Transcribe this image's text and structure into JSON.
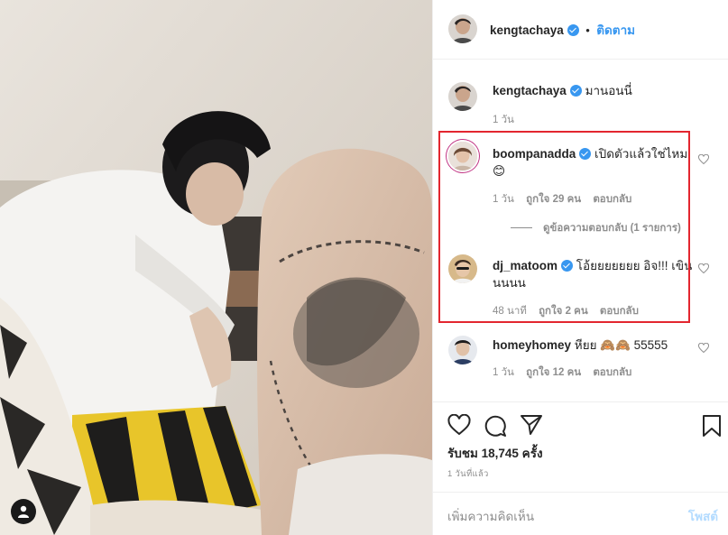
{
  "post": {
    "author": "kengtachaya",
    "follow_label": "ติดตาม",
    "more_label": "..."
  },
  "caption": {
    "user": "kengtachaya",
    "text": "มานอนนี่",
    "time": "1 วัน"
  },
  "comments": [
    {
      "user": "boompanadda",
      "text": "เปิดตัวแล้วใช่ไหม😊",
      "time": "1 วัน",
      "likes": "ถูกใจ 29 คน",
      "reply": "ตอบกลับ",
      "view_replies": "ดูข้อความตอบกลับ (1 รายการ)"
    },
    {
      "user": "dj_matoom",
      "text": "โอ้ยยยยยยย อิจ!!! เขินนนนน",
      "time": "48 นาที",
      "likes": "ถูกใจ 2 คน",
      "reply": "ตอบกลับ"
    },
    {
      "user": "homeyhomey",
      "text": "หียย 🙈🙈 55555",
      "time": "1 วัน",
      "likes": "ถูกใจ 12 คน",
      "reply": "ตอบกลับ"
    }
  ],
  "stats": {
    "views": "รับชม 18,745 ครั้ง",
    "time_ago": "1 วันที่แล้ว"
  },
  "composer": {
    "placeholder": "เพิ่มความคิดเห็น",
    "post_label": "โพสต์"
  },
  "icons": {
    "like": "heart-icon",
    "comment": "comment-icon",
    "share": "share-icon",
    "save": "bookmark-icon",
    "tag": "user-tag-icon"
  },
  "colors": {
    "accent": "#3897f0",
    "highlight": "#e3262f",
    "muted": "#8e8e8e"
  }
}
